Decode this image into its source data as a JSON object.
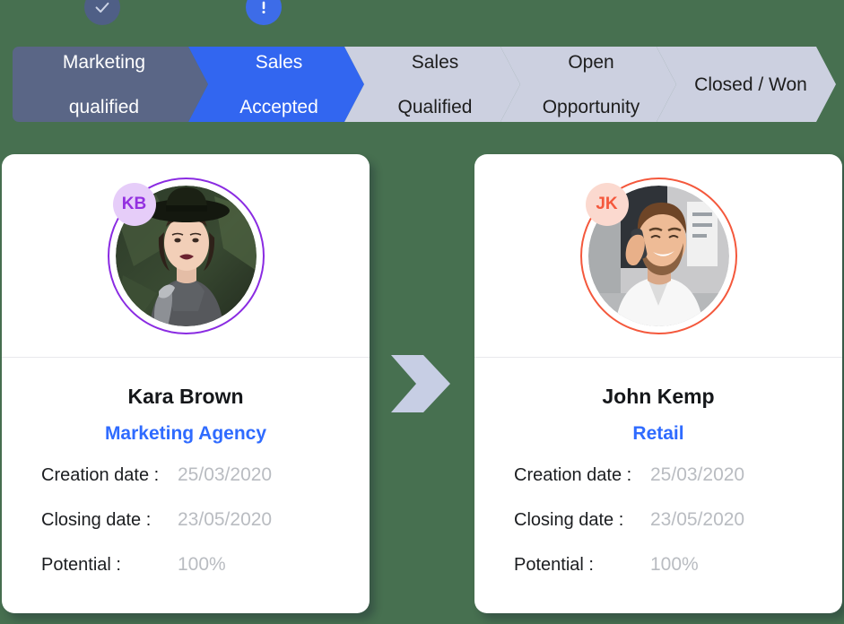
{
  "theme": {
    "background": "#477050",
    "stage_active": "#3266f0",
    "stage_done": "#5a6686",
    "stage_pending": "#ccd0e0",
    "link_color": "#2f6bff",
    "value_color": "#b9bcc1"
  },
  "status_icons": [
    {
      "name": "check-icon",
      "glyph": "check",
      "background": "#4f5f86"
    },
    {
      "name": "alert-icon",
      "glyph": "exclamation",
      "background": "#3d6ce8"
    }
  ],
  "pipeline": {
    "stages": [
      {
        "label": "Marketing qualified",
        "line1": "Marketing",
        "line2": "qualified",
        "state": "completed"
      },
      {
        "label": "Sales Accepted",
        "line1": "Sales",
        "line2": "Accepted",
        "state": "active"
      },
      {
        "label": "Sales Qualified",
        "line1": "Sales",
        "line2": "Qualified",
        "state": "pending"
      },
      {
        "label": "Open Opportunity",
        "line1": "Open",
        "line2": "Opportunity",
        "state": "pending"
      },
      {
        "label": "Closed / Won",
        "line1": "Closed / Won",
        "line2": "",
        "state": "pending"
      }
    ]
  },
  "cards": [
    {
      "initials": "KB",
      "name": "Kara Brown",
      "company": "Marketing Agency",
      "accent": "#8a2be2",
      "badge_bg": "#e6cdf9",
      "badge_fg": "#9330e0",
      "details": [
        {
          "label": "Creation date :",
          "value": "25/03/2020"
        },
        {
          "label": "Closing date :",
          "value": "23/05/2020"
        },
        {
          "label": "Potential :",
          "value": "100%"
        }
      ]
    },
    {
      "initials": "JK",
      "name": "John Kemp",
      "company": "Retail",
      "accent": "#f4583c",
      "badge_bg": "#fbd9cf",
      "badge_fg": "#f4583c",
      "details": [
        {
          "label": "Creation date :",
          "value": "25/03/2020"
        },
        {
          "label": "Closing date :",
          "value": "23/05/2020"
        },
        {
          "label": "Potential :",
          "value": "100%"
        }
      ]
    }
  ],
  "flow_arrow": {
    "name": "flow-arrow-icon",
    "color": "#c7cee4"
  }
}
